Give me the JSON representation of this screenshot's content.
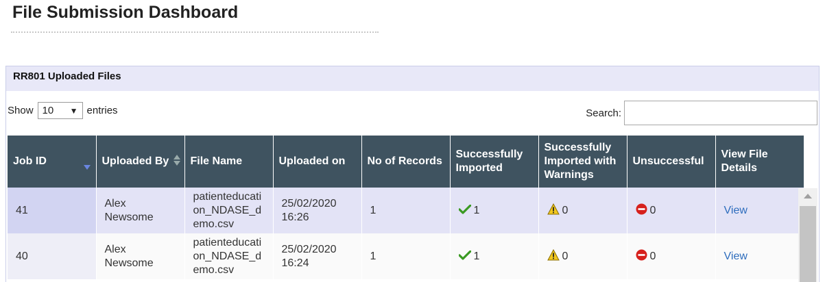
{
  "page": {
    "title": "File Submission Dashboard"
  },
  "panel": {
    "title": "RR801 Uploaded Files"
  },
  "controls": {
    "show_label": "Show",
    "entries_value": "10",
    "entries_label": "entries",
    "search_label": "Search:",
    "search_value": ""
  },
  "table": {
    "columns": [
      {
        "label": "Job ID",
        "sort": "desc"
      },
      {
        "label": "Uploaded By",
        "sort": "both"
      },
      {
        "label": "File Name"
      },
      {
        "label": "Uploaded on"
      },
      {
        "label": "No of Records"
      },
      {
        "label": "Successfully Imported"
      },
      {
        "label": "Successfully Imported with Warnings"
      },
      {
        "label": "Unsuccessful"
      },
      {
        "label": "View File Details"
      }
    ],
    "rows": [
      {
        "job_id": "41",
        "uploaded_by": "Alex Newsome",
        "file_name": "patienteducation_NDASE_demo.csv",
        "uploaded_on": "25/02/2020 16:26",
        "records": "1",
        "imported": "1",
        "warnings": "0",
        "unsuccessful": "0",
        "view": "View"
      },
      {
        "job_id": "40",
        "uploaded_by": "Alex Newsome",
        "file_name": "patienteducation_NDASE_demo.csv",
        "uploaded_on": "25/02/2020 16:24",
        "records": "1",
        "imported": "1",
        "warnings": "0",
        "unsuccessful": "0",
        "view": "View"
      }
    ]
  },
  "colors": {
    "header_bg": "#3f5360",
    "panel_header_bg": "#e8e8f8",
    "row_odd": "#e3e3f6",
    "link": "#2e6dbd",
    "success": "#3a9a22",
    "warning": "#f2c81e",
    "error": "#d6201c"
  },
  "icons": {
    "imported": "check-icon",
    "warnings": "warning-icon",
    "unsuccessful": "no-entry-icon"
  }
}
